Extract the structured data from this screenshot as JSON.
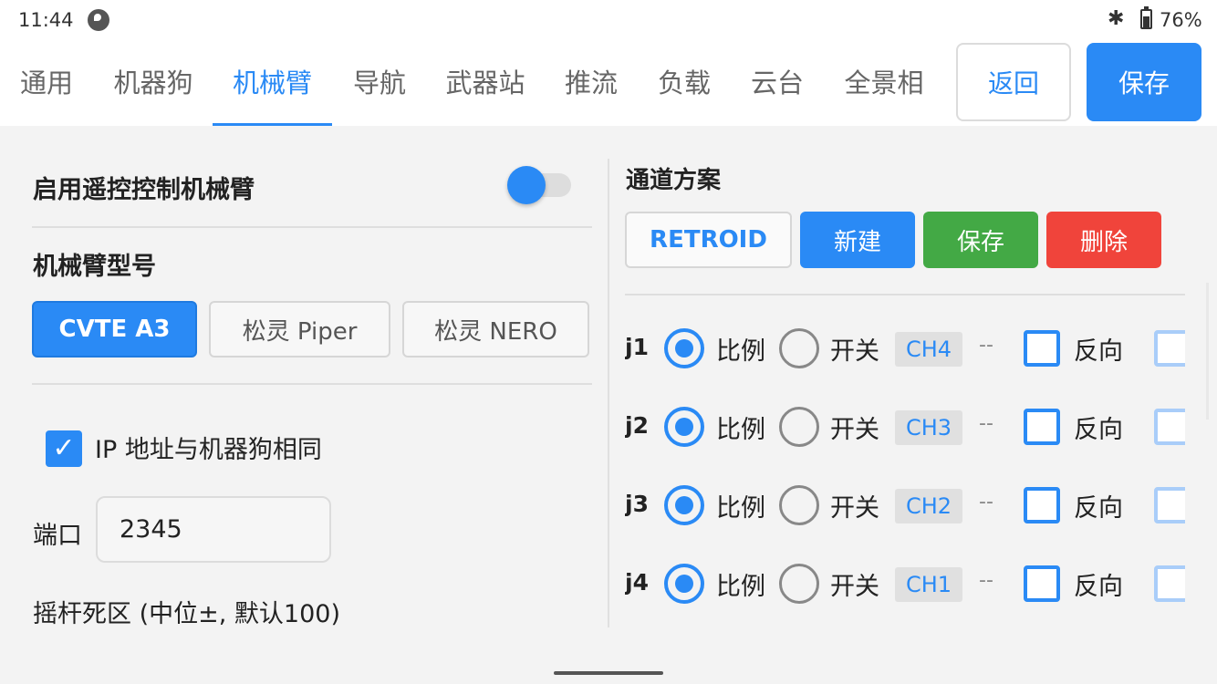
{
  "status": {
    "time": "11:44",
    "battery": "76%",
    "bluetooth_icon": "bluetooth-icon",
    "battery_icon": "battery-charging-icon"
  },
  "tabs": [
    {
      "label": "通用"
    },
    {
      "label": "机器狗"
    },
    {
      "label": "机械臂"
    },
    {
      "label": "导航"
    },
    {
      "label": "武器站"
    },
    {
      "label": "推流"
    },
    {
      "label": "负载"
    },
    {
      "label": "云台"
    },
    {
      "label": "全景相"
    }
  ],
  "active_tab": "机械臂",
  "header": {
    "back_label": "返回",
    "save_label": "保存"
  },
  "left": {
    "enable_remote_label": "启用遥控控制机械臂",
    "enable_remote_on": true,
    "model_title": "机械臂型号",
    "models": [
      {
        "label": "CVTE A3",
        "selected": true
      },
      {
        "label": "松灵 Piper",
        "selected": false
      },
      {
        "label": "松灵 NERO",
        "selected": false
      }
    ],
    "same_ip_label": "IP 地址与机器狗相同",
    "same_ip_checked": true,
    "port_label": "端口",
    "port_value": "2345",
    "deadzone_label": "摇杆死区 (中位±, 默认100)"
  },
  "right": {
    "title": "通道方案",
    "scheme_buttons": {
      "current": "RETROID",
      "new": "新建",
      "save": "保存",
      "delete": "删除"
    },
    "joints": [
      {
        "name": "j1",
        "mode_ratio": "比例",
        "mode_switch": "开关",
        "channel": "CH4",
        "dash": "--",
        "reverse": "反向"
      },
      {
        "name": "j2",
        "mode_ratio": "比例",
        "mode_switch": "开关",
        "channel": "CH3",
        "dash": "--",
        "reverse": "反向"
      },
      {
        "name": "j3",
        "mode_ratio": "比例",
        "mode_switch": "开关",
        "channel": "CH2",
        "dash": "--",
        "reverse": "反向"
      },
      {
        "name": "j4",
        "mode_ratio": "比例",
        "mode_switch": "开关",
        "channel": "CH1",
        "dash": "--",
        "reverse": "反向"
      }
    ]
  },
  "colors": {
    "accent": "#2a8af5",
    "save_green": "#43a945",
    "delete_red": "#f0443b"
  }
}
